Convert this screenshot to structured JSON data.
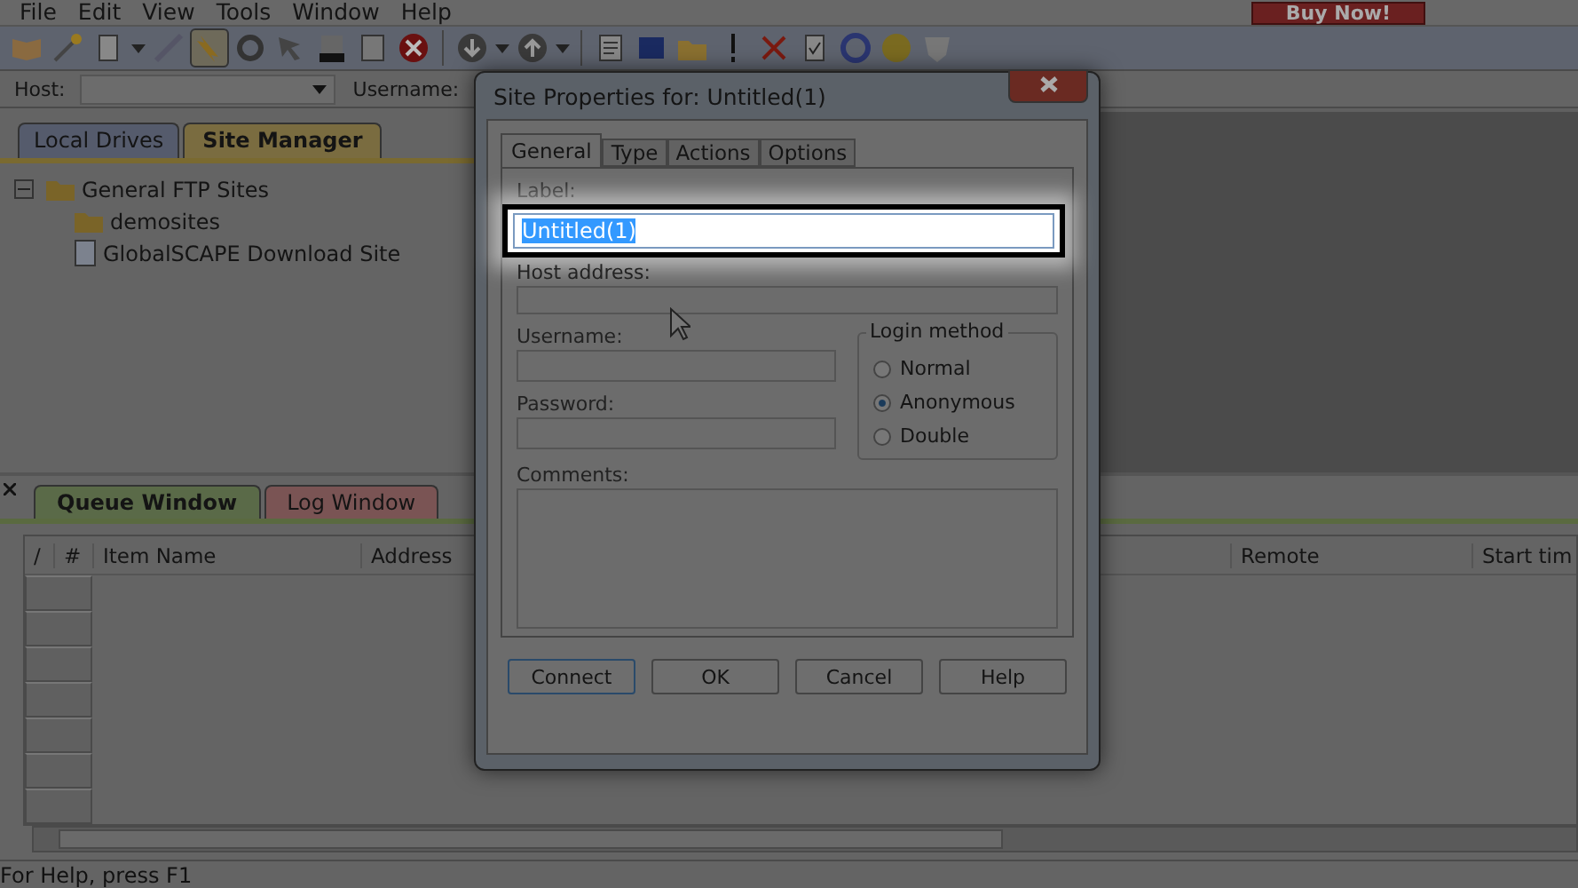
{
  "menu": [
    "File",
    "Edit",
    "View",
    "Tools",
    "Window",
    "Help"
  ],
  "buy_now": "Buy Now!",
  "quickconnect": {
    "host_label": "Host:",
    "username_label": "Username:"
  },
  "left_tabs": [
    {
      "label": "Local Drives",
      "selected": false
    },
    {
      "label": "Site Manager",
      "selected": true
    }
  ],
  "tree": [
    {
      "label": "General FTP Sites",
      "kind": "folder",
      "expanded": true,
      "children": [
        {
          "label": "demosites",
          "kind": "folder"
        },
        {
          "label": "GlobalSCAPE Download Site",
          "kind": "site"
        }
      ]
    }
  ],
  "queue_tabs": [
    {
      "label": "Queue Window",
      "selected": true
    },
    {
      "label": "Log Window",
      "selected": false
    }
  ],
  "queue_columns": [
    "/",
    "#",
    "Item Name",
    "Address",
    "Remote",
    "Start tim"
  ],
  "status_bar": "For Help, press F1",
  "dialog": {
    "title": "Site Properties for: Untitled(1)",
    "tabs": [
      {
        "label": "General",
        "selected": true
      },
      {
        "label": "Type",
        "selected": false
      },
      {
        "label": "Actions",
        "selected": false
      },
      {
        "label": "Options",
        "selected": false
      }
    ],
    "label": {
      "label": "Label:",
      "value": "Untitled(1)",
      "value_selected": true
    },
    "host": {
      "label": "Host address:"
    },
    "username": {
      "label": "Username:"
    },
    "password": {
      "label": "Password:"
    },
    "login_method": {
      "title": "Login method",
      "options": [
        {
          "label": "Normal",
          "selected": false
        },
        {
          "label": "Anonymous",
          "selected": true
        },
        {
          "label": "Double",
          "selected": false
        }
      ]
    },
    "comments": {
      "label": "Comments:"
    },
    "buttons": [
      {
        "label": "Connect",
        "default": true
      },
      {
        "label": "OK",
        "default": false
      },
      {
        "label": "Cancel",
        "default": false
      },
      {
        "label": "Help",
        "default": false
      }
    ]
  }
}
